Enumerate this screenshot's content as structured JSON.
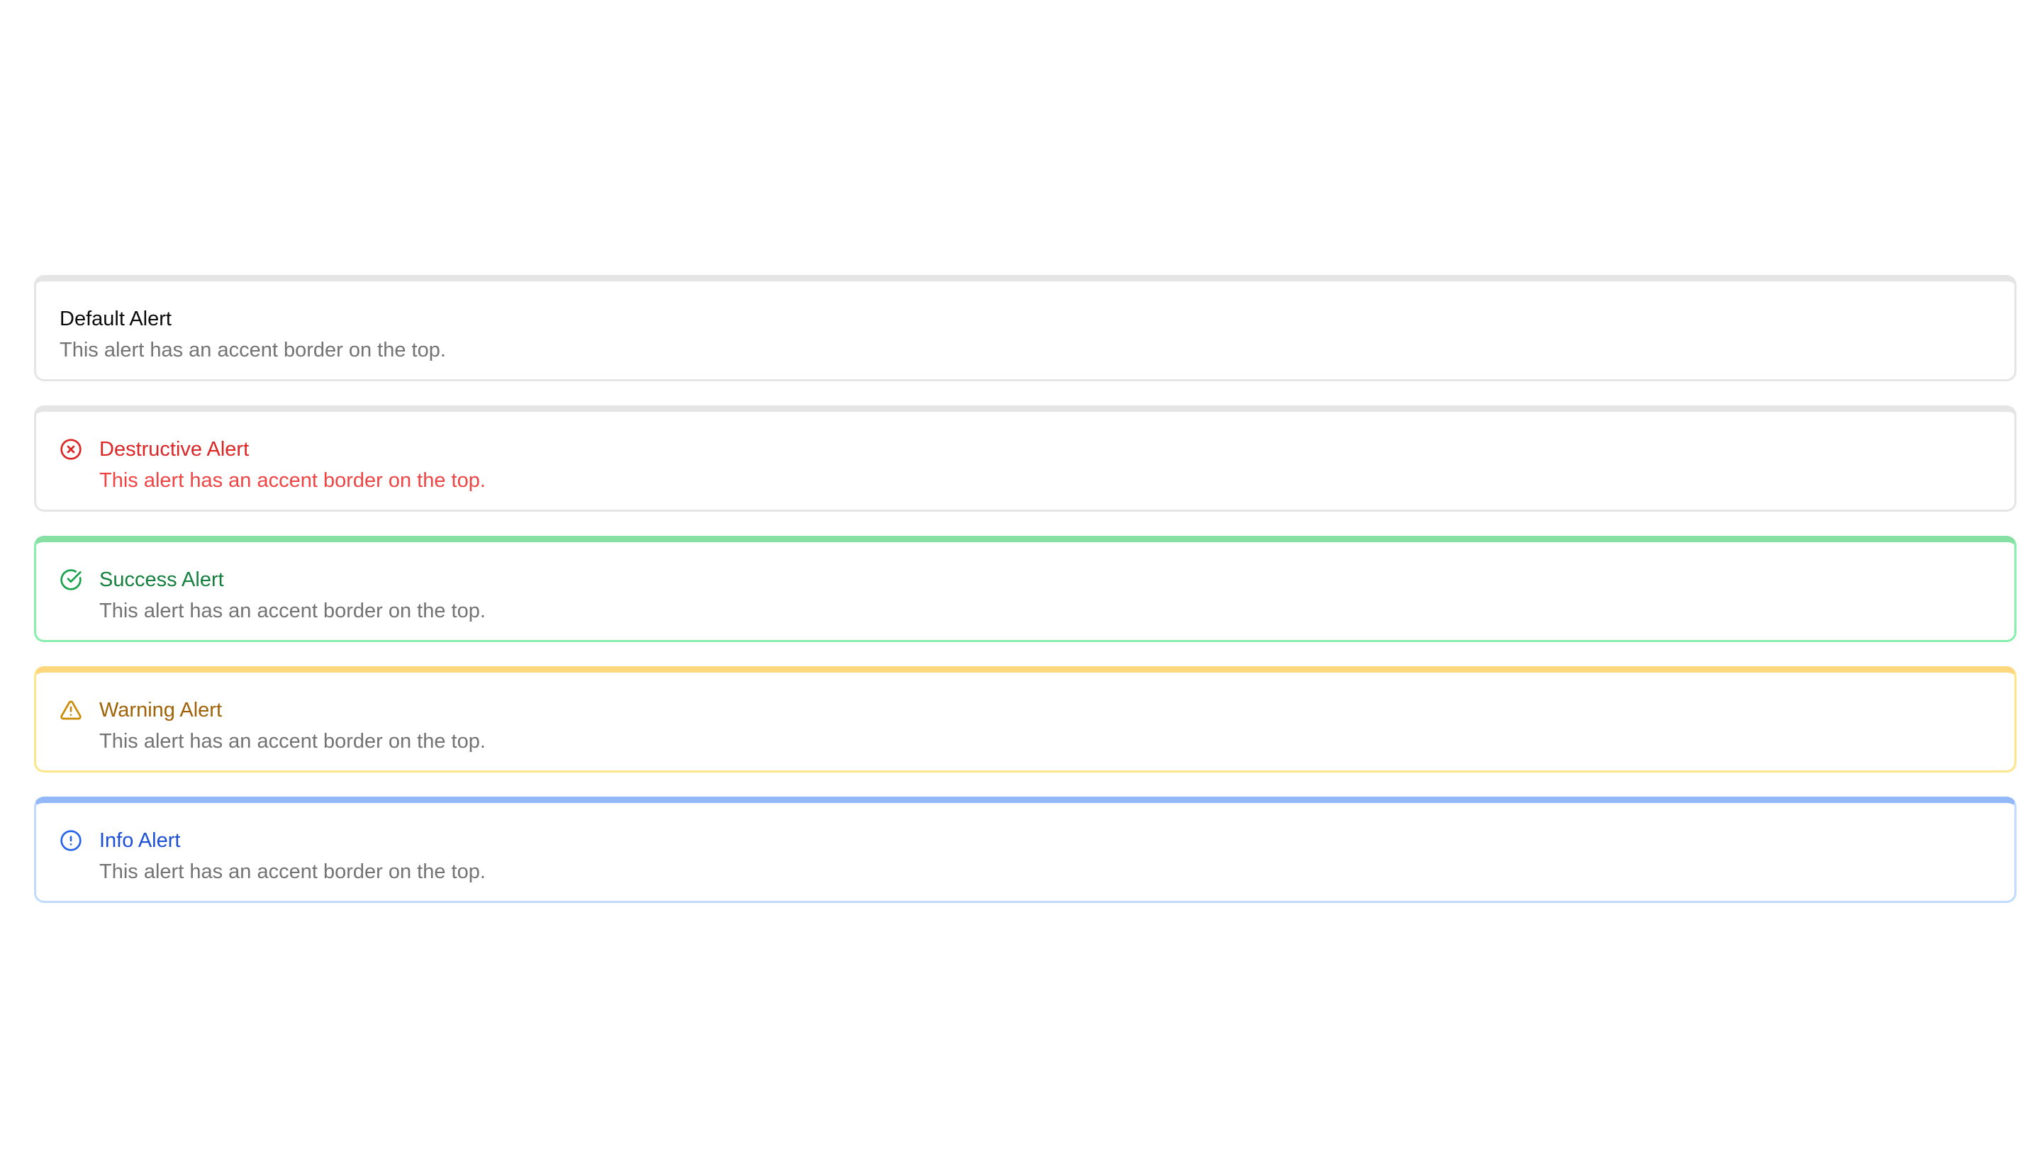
{
  "alerts": [
    {
      "variant": "default",
      "title": "Default Alert",
      "description": "This alert has an accent border on the top.",
      "icon": null
    },
    {
      "variant": "destructive",
      "title": "Destructive Alert",
      "description": "This alert has an accent border on the top.",
      "icon": "circle-x-icon",
      "icon_color": "#dc2626"
    },
    {
      "variant": "success",
      "title": "Success Alert",
      "description": "This alert has an accent border on the top.",
      "icon": "circle-check-icon",
      "icon_color": "#16a34a"
    },
    {
      "variant": "warning",
      "title": "Warning Alert",
      "description": "This alert has an accent border on the top.",
      "icon": "triangle-alert-icon",
      "icon_color": "#ca8a04"
    },
    {
      "variant": "info",
      "title": "Info Alert",
      "description": "This alert has an accent border on the top.",
      "icon": "circle-alert-icon",
      "icon_color": "#2563eb"
    }
  ]
}
